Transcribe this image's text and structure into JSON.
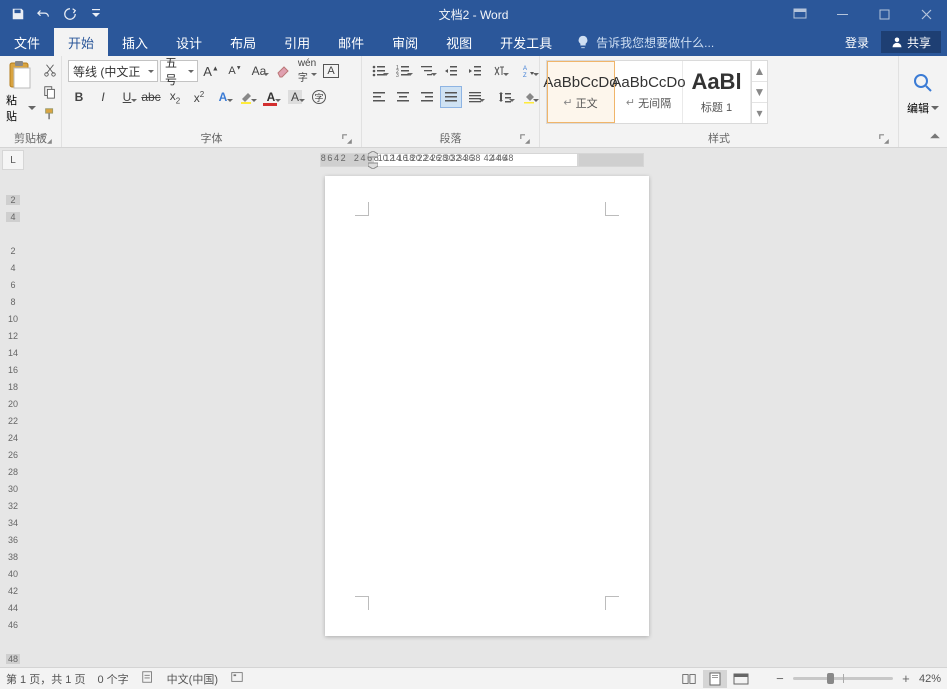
{
  "title": "文档2 - Word",
  "tabs": {
    "file": "文件",
    "home": "开始",
    "insert": "插入",
    "design": "设计",
    "layout": "布局",
    "references": "引用",
    "mailings": "邮件",
    "review": "审阅",
    "view": "视图",
    "developer": "开发工具"
  },
  "tellme": "告诉我您想要做什么...",
  "login": "登录",
  "share": "共享",
  "groups": {
    "clipboard": {
      "label": "剪贴板",
      "paste": "粘贴"
    },
    "font": {
      "label": "字体",
      "name": "等线 (中文正",
      "size": "五号"
    },
    "paragraph": {
      "label": "段落"
    },
    "styles": {
      "label": "样式",
      "items": [
        {
          "preview": "AaBbCcDo",
          "name": "正文",
          "selected": true,
          "icon": "↵"
        },
        {
          "preview": "AaBbCcDo",
          "name": "无间隔",
          "selected": false,
          "icon": "↵"
        },
        {
          "preview": "AaBl",
          "name": "标题 1",
          "selected": false,
          "big": true
        }
      ]
    },
    "editing": {
      "label": "编辑"
    }
  },
  "hruler_ticks": [
    "8",
    "6",
    "4",
    "2",
    "",
    "2",
    "4",
    "6",
    "8",
    "10",
    "12",
    "14",
    "16",
    "18",
    "20",
    "22",
    "24",
    "26",
    "28",
    "30",
    "32",
    "34",
    "36",
    "38",
    "",
    "42",
    "44",
    "46",
    "48"
  ],
  "vruler_ticks": [
    "2",
    "4",
    "",
    "2",
    "4",
    "6",
    "8",
    "10",
    "12",
    "14",
    "16",
    "18",
    "20",
    "22",
    "24",
    "26",
    "28",
    "30",
    "32",
    "34",
    "36",
    "38",
    "40",
    "42",
    "44",
    "46",
    "",
    "48"
  ],
  "corner": "L",
  "status": {
    "page": "第 1 页，共 1 页",
    "words": "0 个字",
    "lang": "中文(中国)",
    "zoom": "42%"
  }
}
